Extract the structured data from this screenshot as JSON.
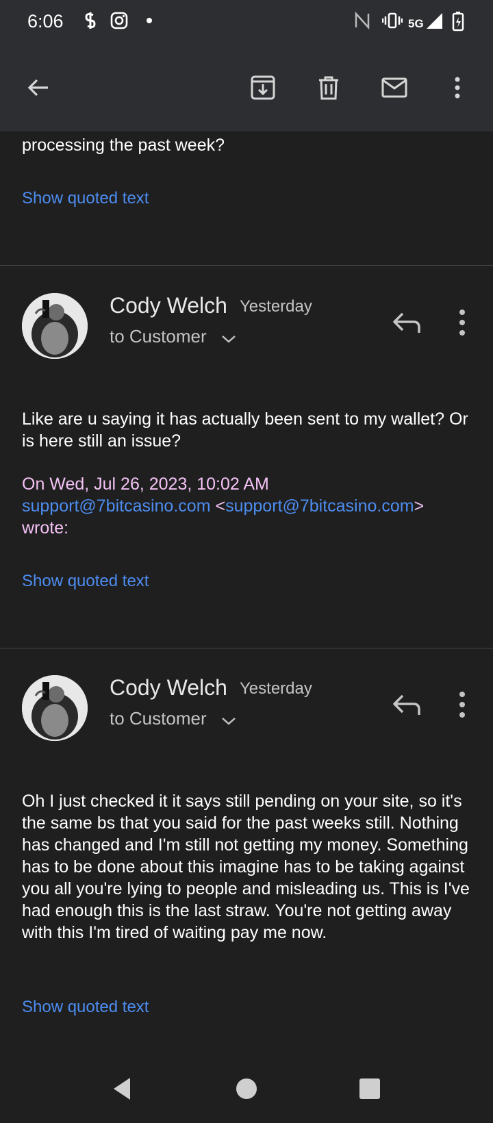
{
  "status_bar": {
    "time": "6:06",
    "network": "5G"
  },
  "toolbar": {
    "icons": [
      "back-arrow-icon",
      "archive-icon",
      "trash-icon",
      "mail-icon",
      "more-vert-icon"
    ]
  },
  "top_partial": {
    "text": "processing the past week?",
    "show_quoted": "Show quoted text"
  },
  "messages": [
    {
      "sender": "Cody Welch",
      "time": "Yesterday",
      "recipient": "to Customer",
      "body": "Like are u saying it has actually been sent to my wallet? Or is here still an issue?",
      "attribution_prefix": "On Wed, Jul 26, 2023, 10:02 AM",
      "email": "support@7bitcasino.com",
      "lt": "<",
      "gt": ">",
      "wrote": "wrote:",
      "show_quoted": "Show quoted text"
    },
    {
      "sender": "Cody Welch",
      "time": "Yesterday",
      "recipient": "to Customer",
      "body": "Oh I just checked it it says still pending on your site, so it's  the same bs that you said for the past weeks still. Nothing has changed and I'm still not getting my money. Something has to be done about this imagine has to be taking against you all you're lying to people and misleading us. This is I've had enough this is the last straw. You're not getting away with this I'm tired of waiting pay me now.",
      "show_quoted": "Show quoted text"
    }
  ],
  "colors": {
    "background": "#1f1f1f",
    "toolbar": "#2d2e31",
    "link": "#4d8cf0",
    "attribution": "#f3c2f4"
  }
}
